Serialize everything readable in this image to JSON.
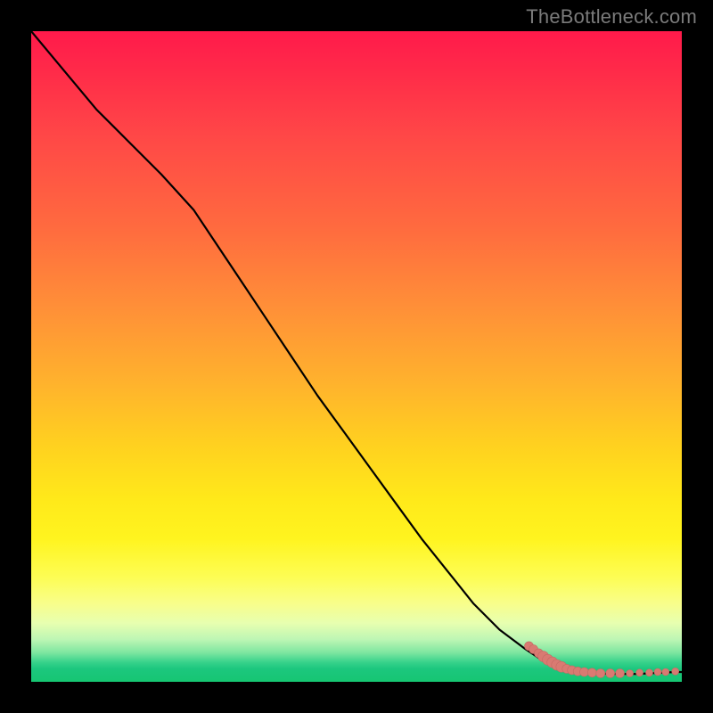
{
  "watermark": "TheBottleneck.com",
  "colors": {
    "line": "#000000",
    "marker_fill": "#d97a72",
    "marker_stroke": "#c46a63"
  },
  "chart_data": {
    "type": "line",
    "title": "",
    "xlabel": "",
    "ylabel": "",
    "xlim": [
      0,
      100
    ],
    "ylim": [
      0,
      100
    ],
    "grid": false,
    "legend": false,
    "series": [
      {
        "name": "curve",
        "style": "line",
        "x": [
          0,
          5,
          10,
          15,
          20,
          25,
          28,
          32,
          36,
          40,
          44,
          48,
          52,
          56,
          60,
          64,
          68,
          72,
          76,
          79,
          81,
          83,
          85,
          87,
          89,
          91,
          93,
          95,
          97,
          99,
          100
        ],
        "y": [
          100,
          94,
          88,
          83,
          78,
          72.5,
          68,
          62,
          56,
          50,
          44,
          38.5,
          33,
          27.5,
          22,
          17,
          12,
          8,
          5,
          3,
          2.3,
          1.8,
          1.5,
          1.3,
          1.2,
          1.2,
          1.2,
          1.3,
          1.4,
          1.5,
          1.5
        ]
      },
      {
        "name": "markers",
        "style": "scatter",
        "points": [
          {
            "x": 76.5,
            "y": 5.5,
            "r": 5
          },
          {
            "x": 77.2,
            "y": 5.0,
            "r": 5
          },
          {
            "x": 78.0,
            "y": 4.4,
            "r": 5
          },
          {
            "x": 78.7,
            "y": 3.9,
            "r": 6
          },
          {
            "x": 79.4,
            "y": 3.4,
            "r": 6
          },
          {
            "x": 80.1,
            "y": 3.0,
            "r": 6
          },
          {
            "x": 80.8,
            "y": 2.6,
            "r": 6
          },
          {
            "x": 81.5,
            "y": 2.3,
            "r": 6
          },
          {
            "x": 82.3,
            "y": 2.0,
            "r": 5
          },
          {
            "x": 83.1,
            "y": 1.8,
            "r": 5
          },
          {
            "x": 84.0,
            "y": 1.6,
            "r": 5
          },
          {
            "x": 85.0,
            "y": 1.5,
            "r": 5
          },
          {
            "x": 86.2,
            "y": 1.4,
            "r": 5
          },
          {
            "x": 87.5,
            "y": 1.3,
            "r": 5
          },
          {
            "x": 89.0,
            "y": 1.3,
            "r": 5
          },
          {
            "x": 90.5,
            "y": 1.3,
            "r": 5
          },
          {
            "x": 92.0,
            "y": 1.3,
            "r": 4
          },
          {
            "x": 93.5,
            "y": 1.4,
            "r": 4
          },
          {
            "x": 95.0,
            "y": 1.4,
            "r": 4
          },
          {
            "x": 96.3,
            "y": 1.5,
            "r": 4
          },
          {
            "x": 97.5,
            "y": 1.5,
            "r": 4
          },
          {
            "x": 99.0,
            "y": 1.6,
            "r": 4
          }
        ]
      }
    ]
  }
}
